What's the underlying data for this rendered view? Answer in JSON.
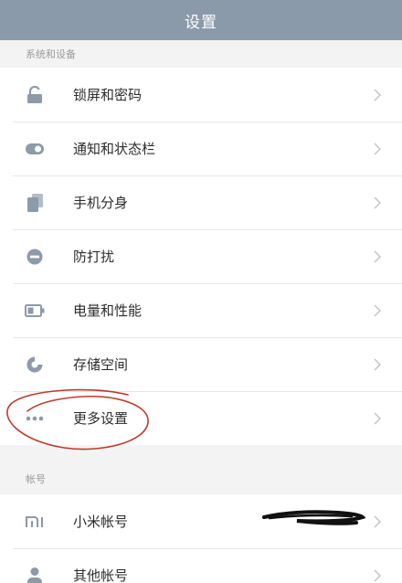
{
  "header": {
    "title": "设置"
  },
  "colors": {
    "titlebar": "#8a9aab",
    "icon": "#8d9aa8",
    "annotation": "#c0392b"
  },
  "sections": [
    {
      "title": "系统和设备",
      "items": [
        {
          "label": "锁屏和密码",
          "icon": "lock-icon"
        },
        {
          "label": "通知和状态栏",
          "icon": "toggle-icon"
        },
        {
          "label": "手机分身",
          "icon": "phone-clone-icon"
        },
        {
          "label": "防打扰",
          "icon": "do-not-disturb-icon"
        },
        {
          "label": "电量和性能",
          "icon": "battery-icon"
        },
        {
          "label": "存储空间",
          "icon": "storage-pie-icon"
        },
        {
          "label": "更多设置",
          "icon": "more-dots-icon"
        }
      ]
    },
    {
      "title": "帐号",
      "items": [
        {
          "label": "小米帐号",
          "icon": "mi-logo-icon"
        },
        {
          "label": "其他帐号",
          "icon": "person-icon"
        }
      ]
    }
  ]
}
